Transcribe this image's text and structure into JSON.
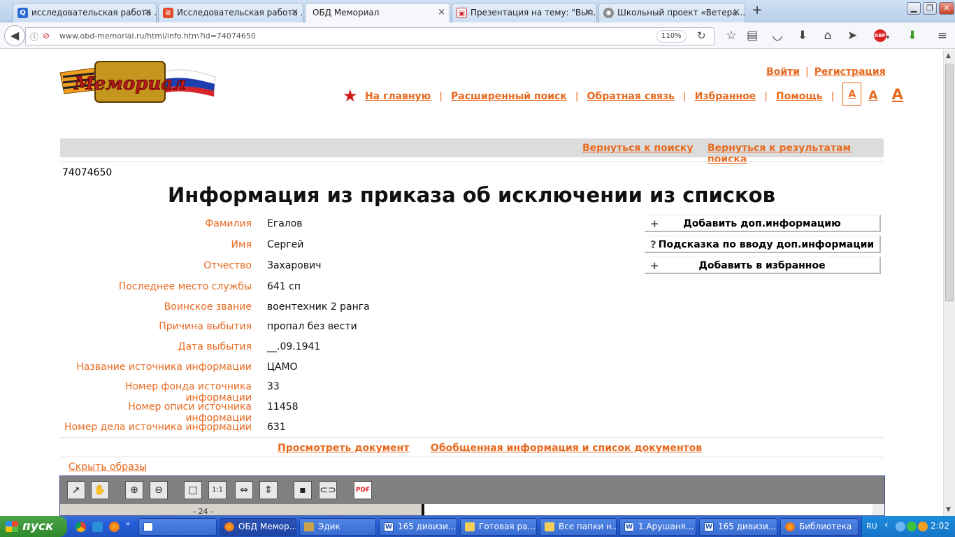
{
  "browser": {
    "tabs": [
      {
        "title": "исследовательская работа ...",
        "active": false
      },
      {
        "title": "Исследовательская работа ...",
        "active": false
      },
      {
        "title": "ОБД Мемориал",
        "active": true
      },
      {
        "title": "Презентация на тему: \"Вып...",
        "active": false
      },
      {
        "title": "Школьный проект «Ветера...",
        "active": false
      }
    ],
    "new_tab": "+",
    "url": "www.obd-memorial.ru/html/info.htm?id=74074650",
    "zoom": "110%"
  },
  "site": {
    "logo_text": "Мемориал",
    "login": "Войти",
    "register": "Регистрация",
    "nav": {
      "home": "На главную",
      "advanced_search": "Расширенный поиск",
      "feedback": "Обратная связь",
      "favorites": "Избранное",
      "help": "Помощь"
    },
    "font_sizes": [
      "A",
      "A",
      "A"
    ],
    "back_to_search": "Вернуться к поиску",
    "back_to_results": "Вернуться к результатам поиска"
  },
  "record": {
    "id": "74074650",
    "title": "Информация из приказа об исключении из списков",
    "fields": [
      {
        "label": "Фамилия",
        "value": "Егалов"
      },
      {
        "label": "Имя",
        "value": "Сергей"
      },
      {
        "label": "Отчество",
        "value": "Захарович"
      },
      {
        "label": "Последнее место службы",
        "value": "641 сп"
      },
      {
        "label": "Воинское звание",
        "value": "воентехник 2 ранга"
      },
      {
        "label": "Причина выбытия",
        "value": "пропал без вести"
      },
      {
        "label": "Дата выбытия",
        "value": "__.09.1941"
      },
      {
        "label": "Название источника информации",
        "value": "ЦАМО"
      },
      {
        "label": "Номер фонда источника информации",
        "value": "33"
      },
      {
        "label": "Номер описи источника информации",
        "value": "11458"
      },
      {
        "label": "Номер дела источника информации",
        "value": "631"
      }
    ],
    "actions": [
      {
        "icon": "+",
        "label": "Добавить доп.информацию"
      },
      {
        "icon": "?",
        "label": "Подсказка по вводу доп.информации"
      },
      {
        "icon": "+",
        "label": "Добавить в избранное"
      }
    ],
    "view_document": "Просмотреть документ",
    "summary_link": "Обобщенная информация и список документов",
    "hide_images": "Скрыть образы",
    "doc_fragment": "- 24 -"
  },
  "viewer": {
    "zoom_1to1": "1:1"
  },
  "taskbar": {
    "start": "пуск",
    "items": [
      {
        "label": "",
        "active": false
      },
      {
        "label": "ОБД Мемор...",
        "active": true
      },
      {
        "label": "Эдик",
        "active": false
      },
      {
        "label": "165 дивизи...",
        "active": false
      },
      {
        "label": "Готовая ра...",
        "active": false
      },
      {
        "label": "Все папки н...",
        "active": false
      },
      {
        "label": "1.Арушаня...",
        "active": false
      },
      {
        "label": "165 дивизи...",
        "active": false
      },
      {
        "label": "Библиотека",
        "active": false
      }
    ],
    "lang": "RU",
    "clock": "2:02"
  },
  "colors": {
    "accent": "#e86a20",
    "star": "#d01a1a"
  }
}
